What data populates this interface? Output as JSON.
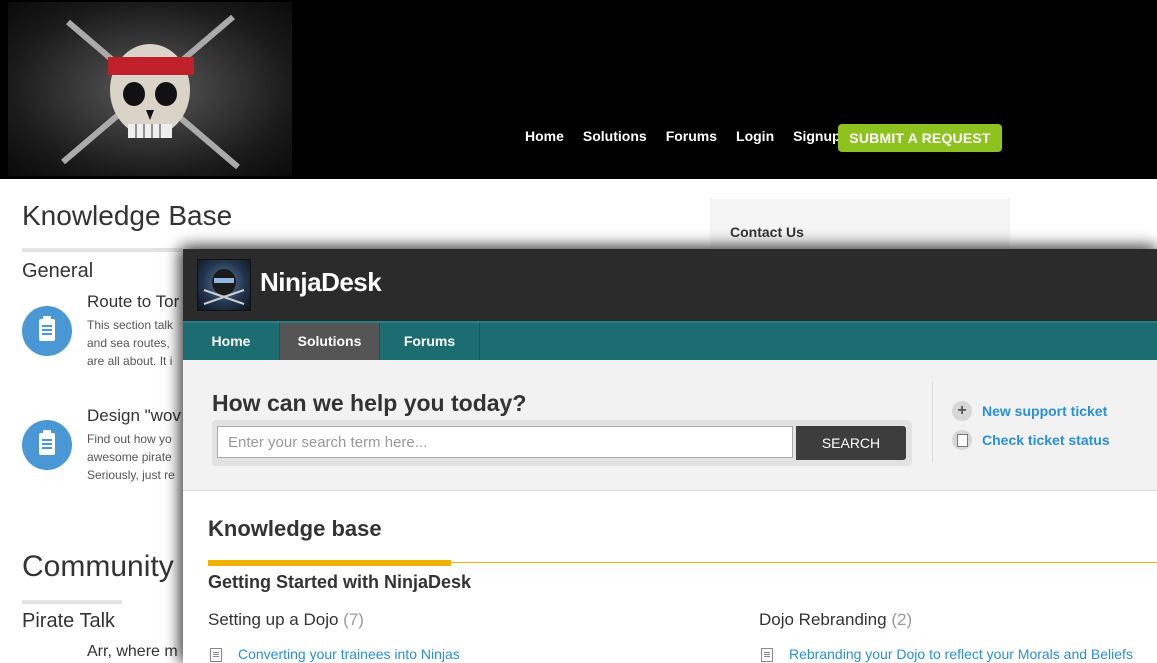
{
  "pirate_site": {
    "nav": [
      "Home",
      "Solutions",
      "Forums",
      "Login",
      "Signup"
    ],
    "submit_button": "SUBMIT A REQUEST",
    "kb_title": "Knowledge Base",
    "general_title": "General",
    "articles": [
      {
        "title": "Route to Tor",
        "lines": [
          "This section talk",
          "and sea routes,",
          "are all about. It i"
        ]
      },
      {
        "title": "Design \"wov",
        "lines": [
          "Find out how yo",
          "awesome pirate",
          "Seriously, just re"
        ]
      }
    ],
    "community_title": "Community",
    "pirate_talk_title": "Pirate Talk",
    "pirate_talk_text": "Arr, where m",
    "contact_us": "Contact Us"
  },
  "ninjadesk": {
    "brand": "NinjaDesk",
    "tabs": [
      "Home",
      "Solutions",
      "Forums"
    ],
    "active_tab": "Solutions",
    "hero_title": "How can we help you today?",
    "search_placeholder": "Enter your search term here...",
    "search_button": "SEARCH",
    "new_ticket": "New support ticket",
    "check_status": "Check ticket status",
    "kb_title": "Knowledge base",
    "category": "Getting Started with NinjaDesk",
    "sections": [
      {
        "name": "Setting up a Dojo",
        "count": "(7)",
        "link": "Converting your trainees into Ninjas"
      },
      {
        "name": "Dojo Rebranding",
        "count": "(2)",
        "link": "Rebranding your Dojo to reflect your Morals and Beliefs"
      }
    ]
  },
  "colors": {
    "submit_green": "#8dc21f",
    "nav_teal": "#1b6d72",
    "link_blue": "#2a8fd4",
    "accent_gold": "#f0b400"
  }
}
